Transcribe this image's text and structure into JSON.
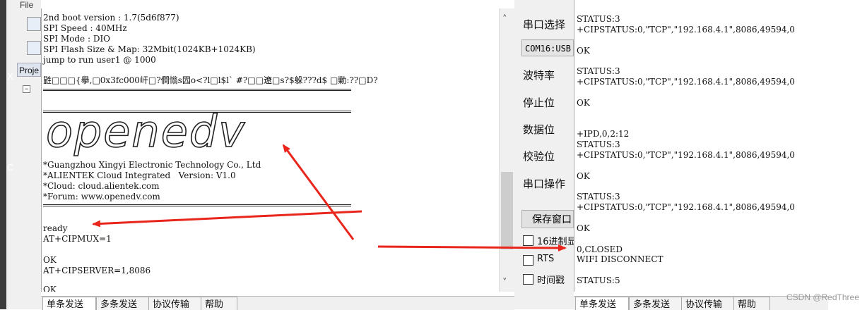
{
  "ide": {
    "menu_hint": "File",
    "project_tab": "Proje",
    "side_glyph_x": "X",
    "side_glyph_c": "C",
    "tree_toggle": "−"
  },
  "terminal_left": {
    "lines": [
      "2nd boot version : 1.7(5d6f877)",
      "SPI Speed : 40MHz",
      "SPI Mode : DIO",
      "SPI Flash Size & Map: 32Mbit(1024KB+1024KB)",
      "jump to run user1 @ 1000",
      "鼪□□□{擧,□0x3fc000屽□?僴慃s囥o<?l□l$l` #?□□遼□s?$躲???d$ □勦:??□D?",
      "*Guangzhou Xingyi Electronic Technology Co., Ltd",
      "*ALIENTEK Cloud Integrated   Version: V1.0",
      "*Cloud: cloud.alientek.com",
      "*Forum: www.openedv.com",
      "ready",
      "AT+CIPMUX=1",
      "OK",
      "AT+CIPSERVER=1,8086",
      "OK"
    ],
    "logo_text": "openedv"
  },
  "panel": {
    "port_select_label": "串口选择",
    "port_value": "COM16:USB",
    "baud_label": "波特率",
    "stop_bits_label": "停止位",
    "data_bits_label": "数据位",
    "parity_label": "校验位",
    "port_op_label": "串口操作",
    "save_window_button": "保存窗口",
    "hex_display_label": "16进制显",
    "rts_label": "RTS",
    "timestamp_label": "时间戳"
  },
  "terminal_right": {
    "lines": [
      "STATUS:3",
      "+CIPSTATUS:0,\"TCP\",\"192.168.4.1\",8086,49594,0",
      "OK",
      "STATUS:3",
      "+CIPSTATUS:0,\"TCP\",\"192.168.4.1\",8086,49594,0",
      "OK",
      "+IPD,0,2:12",
      "STATUS:3",
      "+CIPSTATUS:0,\"TCP\",\"192.168.4.1\",8086,49594,0",
      "OK",
      "STATUS:3",
      "+CIPSTATUS:0,\"TCP\",\"192.168.4.1\",8086,49594,0",
      "OK",
      "0,CLOSED",
      "WIFI DISCONNECT",
      "STATUS:5"
    ]
  },
  "tabs_left": [
    "单条发送",
    "多条发送",
    "协议传输",
    "帮助"
  ],
  "tabs_right": [
    "单条发送",
    "多条发送",
    "协议传输",
    "帮助"
  ],
  "watermark": "CSDN @RedThree",
  "colors": {
    "arrow": "#e8261c",
    "panel_bg": "#f0f0f0"
  }
}
